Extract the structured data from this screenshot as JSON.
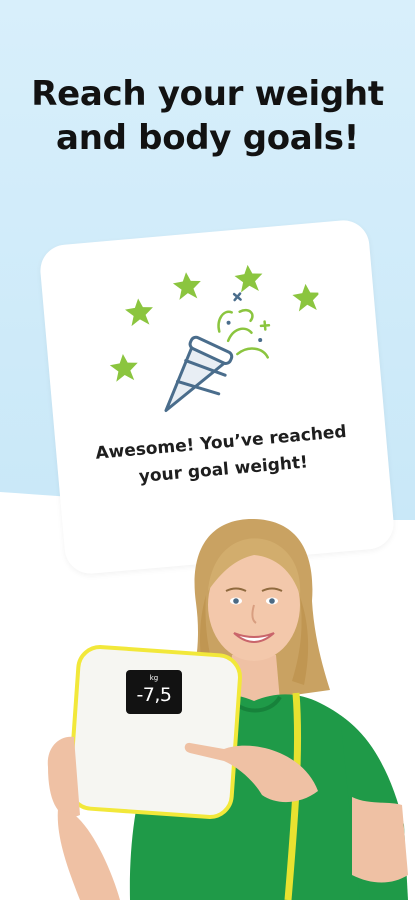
{
  "headline": {
    "line1": "Reach your weight",
    "line2": "and body goals!"
  },
  "card": {
    "message_line1": "Awesome! You’ve reached",
    "message_line2": "your goal weight!",
    "icon": "party-popper-icon",
    "decoration_icon": "star-icon"
  },
  "scale": {
    "unit": "kg",
    "value": "-7,5"
  },
  "colors": {
    "background_top": "#cfeaf9",
    "background_bottom": "#ffffff",
    "star_green": "#8bc53f",
    "popper_blue": "#4a6d8c",
    "scale_yellow": "#f2e83a",
    "shirt_green": "#1f9a48"
  }
}
